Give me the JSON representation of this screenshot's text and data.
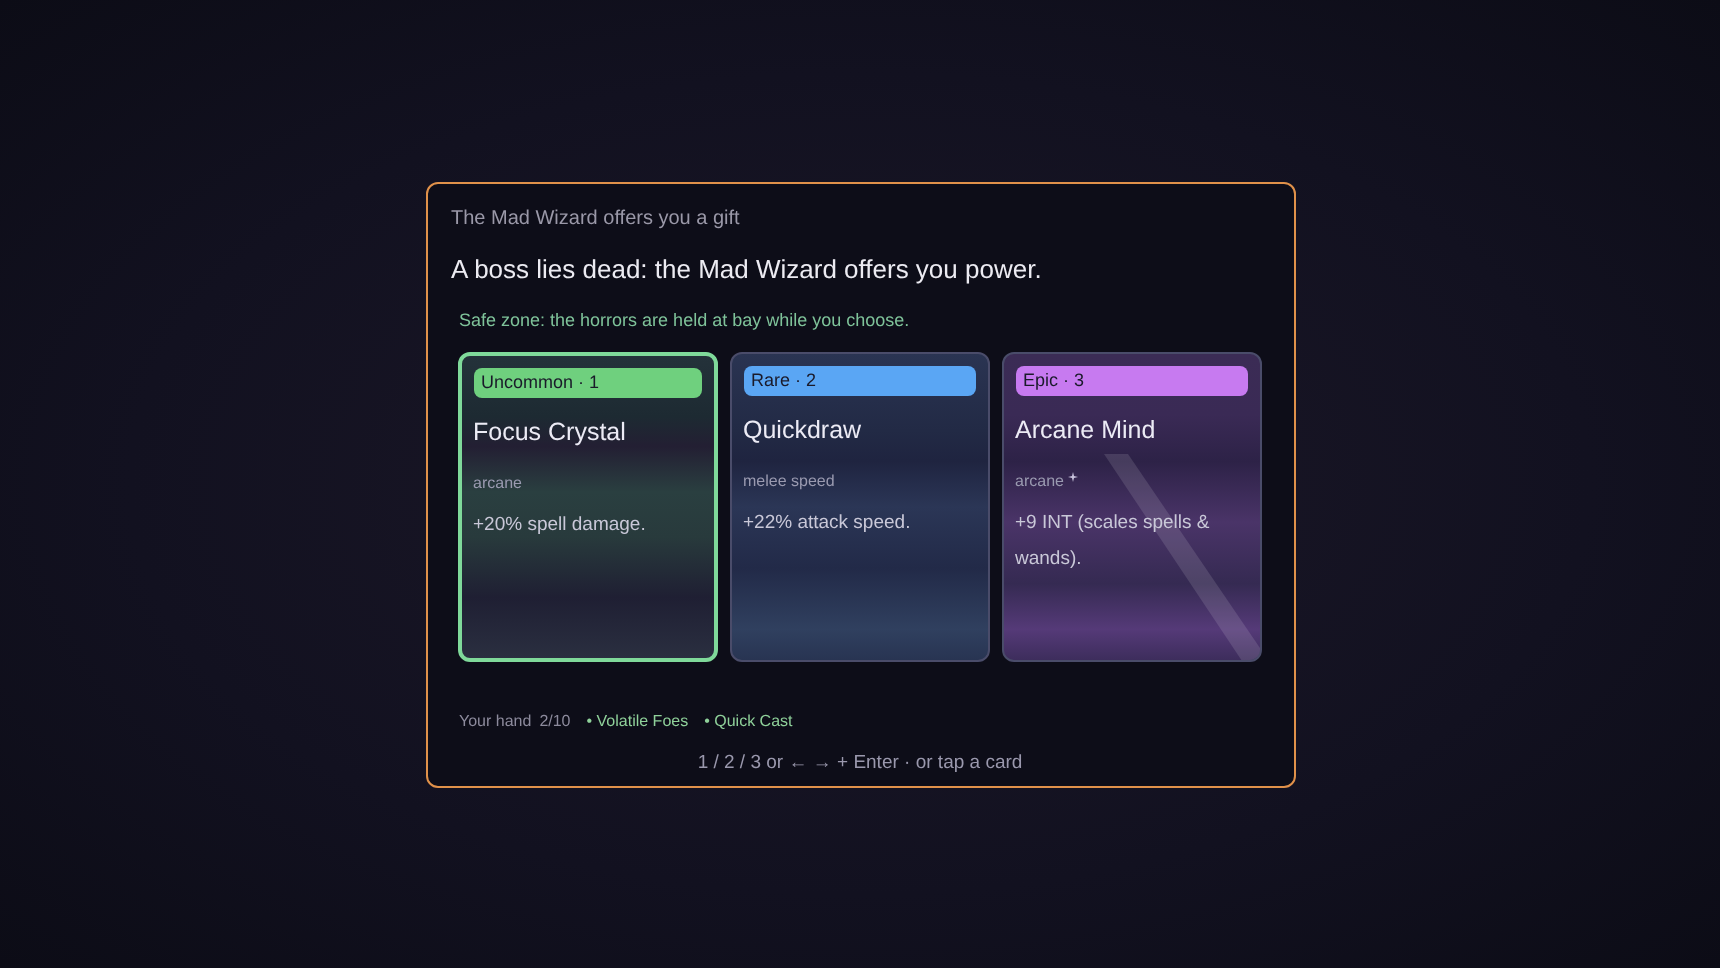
{
  "dialog": {
    "kicker": "The Mad Wizard offers you a gift",
    "title": "A boss lies dead: the Mad Wizard offers you power.",
    "notice": "Safe zone: the horrors are held at bay while you choose."
  },
  "cards": [
    {
      "kind": "uncommon",
      "badge": "Uncommon · 1",
      "color": "#6fd07e",
      "name": "Focus Crystal",
      "tag": "arcane",
      "effect": "+20% spell damage.",
      "selected": true,
      "sparkle": false
    },
    {
      "kind": "rare",
      "badge": "Rare · 2",
      "color": "#5aa6f4",
      "name": "Quickdraw",
      "tag": "melee speed",
      "effect": "+22% attack speed.",
      "selected": false,
      "sparkle": false
    },
    {
      "kind": "epic",
      "badge": "Epic · 3",
      "color": "#c77af0",
      "name": "Arcane Mind",
      "tag": "arcane",
      "effect": "+9 INT (scales spells & wands).",
      "selected": false,
      "sparkle": true
    }
  ],
  "hand": {
    "label": "Your hand",
    "count": "2/10",
    "items": [
      "• Volatile Foes",
      "• Quick Cast"
    ]
  },
  "hint": "1 / 2 / 3 or ← → + Enter · or tap a card"
}
